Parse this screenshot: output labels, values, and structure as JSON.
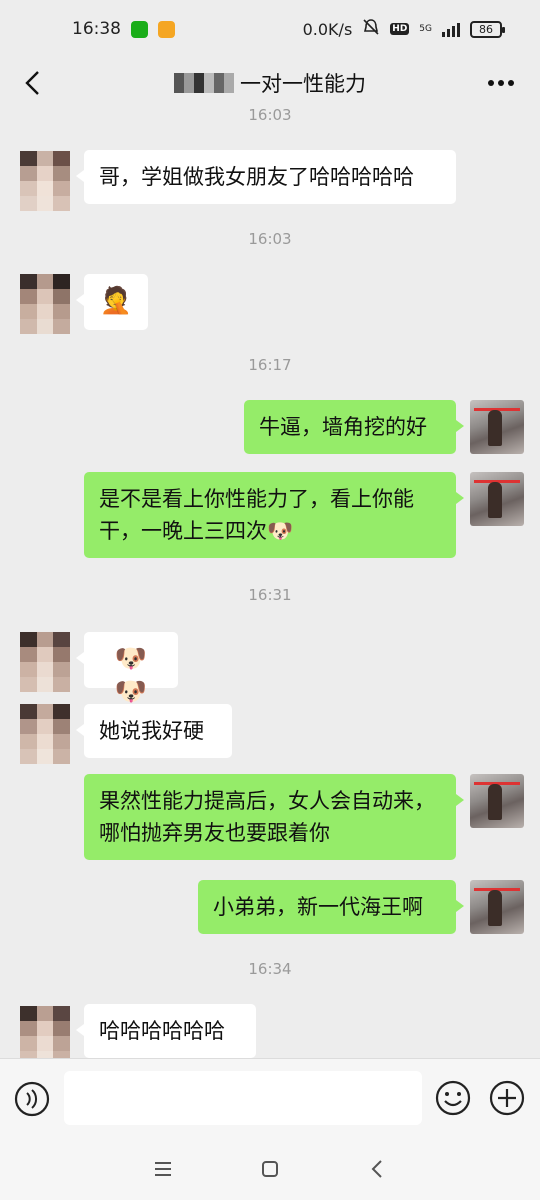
{
  "status_bar": {
    "time": "16:38",
    "speed": "0.0K/s",
    "hd": "HD",
    "network": "5G",
    "battery": "86"
  },
  "header": {
    "title": "一对一性能力"
  },
  "messages": [
    {
      "type": "time",
      "text": "16:03"
    },
    {
      "type": "in",
      "text": "哥，学姐做我女朋友了哈哈哈哈哈"
    },
    {
      "type": "time",
      "text": "16:03"
    },
    {
      "type": "in",
      "text": "🤦"
    },
    {
      "type": "time",
      "text": "16:17"
    },
    {
      "type": "out",
      "text": "牛逼，墙角挖的好"
    },
    {
      "type": "out",
      "text": "是不是看上你性能力了，看上你能干，一晚上三四次🐶"
    },
    {
      "type": "time",
      "text": "16:31"
    },
    {
      "type": "in",
      "text": "🐶🐶"
    },
    {
      "type": "in",
      "text": "她说我好硬"
    },
    {
      "type": "out",
      "text": "果然性能力提高后，女人会自动来，哪怕抛弃男友也要跟着你"
    },
    {
      "type": "out",
      "text": "小弟弟，新一代海王啊"
    },
    {
      "type": "time",
      "text": "16:34"
    },
    {
      "type": "in",
      "text": "哈哈哈哈哈哈"
    }
  ],
  "icons": {
    "back": "back-arrow-icon",
    "more": "more-dots-icon",
    "voice": "voice-icon",
    "emoji": "emoji-icon",
    "plus": "plus-icon"
  },
  "colors": {
    "background": "#ededed",
    "outgoing_bubble": "#95ec69",
    "incoming_bubble": "#ffffff",
    "time_label": "#9a9a9a"
  }
}
